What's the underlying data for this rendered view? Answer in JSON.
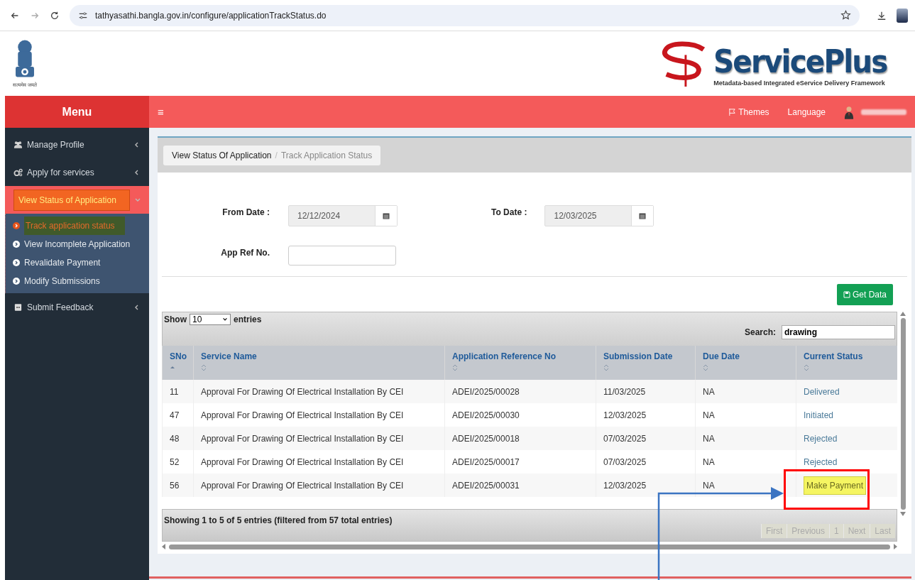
{
  "browser": {
    "url": "tathyasathi.bangla.gov.in/configure/applicationTrackStatus.do"
  },
  "header": {
    "emblem_motto": "सत्यमेव जयते",
    "brand": "ServicePlus",
    "tagline": "Metadata-based Integrated eService Delivery Framework"
  },
  "topbar": {
    "menu_title": "Menu",
    "hamburger": "≡",
    "themes": "Themes",
    "language": "Language"
  },
  "sidebar": {
    "items": [
      {
        "label": "Manage Profile",
        "kind": "users",
        "expanded": false,
        "selected": false
      },
      {
        "label": "Apply for services",
        "kind": "gears",
        "expanded": false,
        "selected": false
      },
      {
        "label": "View Status of Application",
        "kind": "square",
        "expanded": true,
        "selected": true,
        "children": [
          {
            "label": "Track application status",
            "selected": true
          },
          {
            "label": "View Incomplete Application",
            "selected": false
          },
          {
            "label": "Revalidate Payment",
            "selected": false
          },
          {
            "label": "Modify Submissions",
            "selected": false
          }
        ]
      },
      {
        "label": "Submit Feedback",
        "kind": "square",
        "expanded": false,
        "selected": false
      }
    ]
  },
  "breadcrumb": {
    "separator": "/",
    "items": [
      "View Status Of Application",
      "Track Application Status"
    ]
  },
  "form": {
    "from_label": "From Date :",
    "from_value": "12/12/2024",
    "to_label": "To Date :",
    "to_value": "12/03/2025",
    "ref_label": "App Ref No.",
    "button": "Get Data"
  },
  "table": {
    "show_label": "Show",
    "page_size": "10",
    "entries_label": "entries",
    "search_label": "Search:",
    "search_value": "drawing",
    "columns": [
      {
        "label": "SNo",
        "sorted": true
      },
      {
        "label": "Service Name",
        "sorted": false
      },
      {
        "label": "Application Reference No",
        "sorted": false
      },
      {
        "label": "Submission Date",
        "sorted": false
      },
      {
        "label": "Due Date",
        "sorted": false
      },
      {
        "label": "Current Status",
        "sorted": false
      }
    ],
    "rows": [
      {
        "sno": "11",
        "service": "Approval For Drawing Of Electrical Installation By CEI",
        "ref": "ADEI/2025/00028",
        "submitted": "11/03/2025",
        "due": "NA",
        "status": "Delivered",
        "kind": "link",
        "highlighted": false
      },
      {
        "sno": "47",
        "service": "Approval For Drawing Of Electrical Installation By CEI",
        "ref": "ADEI/2025/00030",
        "submitted": "12/03/2025",
        "due": "NA",
        "status": "Initiated",
        "kind": "link",
        "highlighted": false
      },
      {
        "sno": "48",
        "service": "Approval For Drawing Of Electrical Installation By CEI",
        "ref": "ADEI/2025/00018",
        "submitted": "07/03/2025",
        "due": "NA",
        "status": "Rejected",
        "kind": "link",
        "highlighted": false
      },
      {
        "sno": "52",
        "service": "Approval For Drawing Of Electrical Installation By CEI",
        "ref": "ADEI/2025/00017",
        "submitted": "07/03/2025",
        "due": "NA",
        "status": "Rejected",
        "kind": "link",
        "highlighted": false
      },
      {
        "sno": "56",
        "service": "Approval For Drawing Of Electrical Installation By CEI",
        "ref": "ADEI/2025/00031",
        "submitted": "12/03/2025",
        "due": "NA",
        "status": "Make Payment",
        "kind": "action",
        "highlighted": true
      }
    ],
    "info": "Showing 1 to 5 of 5 entries (filtered from 57 total entries)",
    "pagination": [
      {
        "label": "First",
        "disabled": true
      },
      {
        "label": "Previous",
        "disabled": true
      },
      {
        "label": "1",
        "disabled": true
      },
      {
        "label": "Next",
        "disabled": true
      },
      {
        "label": "Last",
        "disabled": true
      }
    ]
  }
}
